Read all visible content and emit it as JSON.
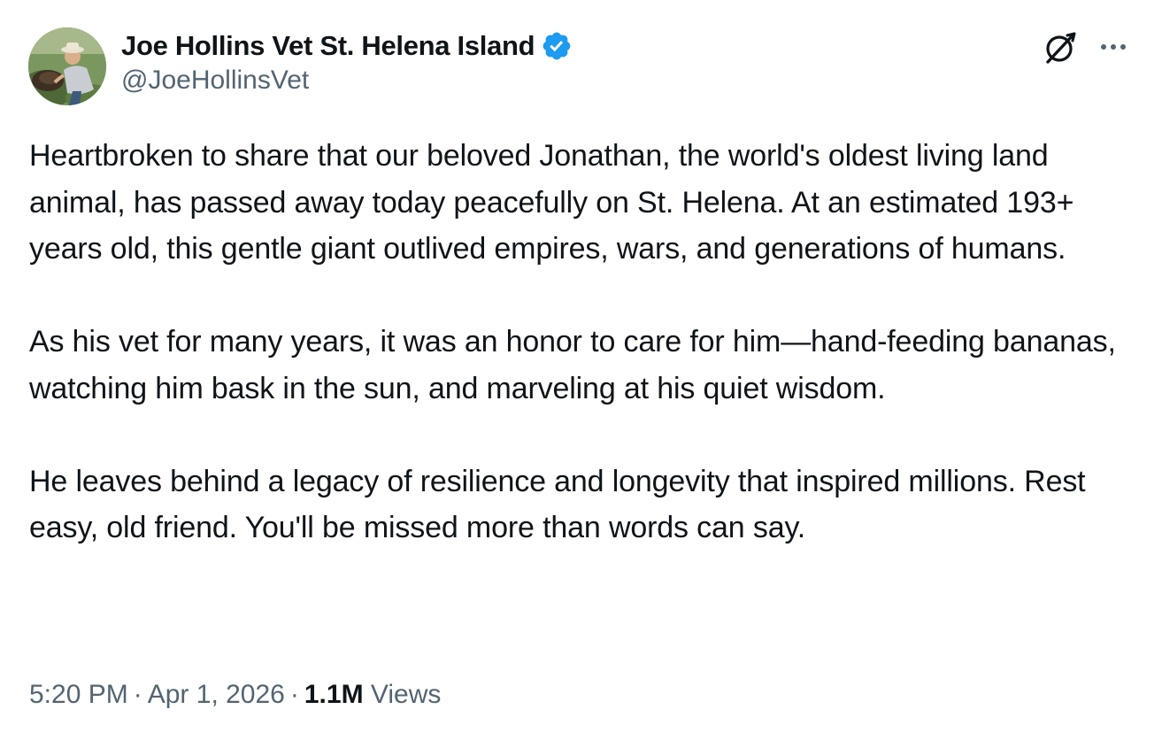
{
  "author": {
    "display_name": "Joe Hollins Vet St. Helena Island",
    "handle": "@JoeHollinsVet",
    "verified": true
  },
  "tweet": {
    "paragraphs": [
      "Heartbroken to share that our beloved Jonathan, the world's oldest living land animal, has passed away today peacefully on St. Helena. At an estimated 193+ years old, this gentle giant outlived empires, wars, and generations of humans.",
      "As his vet for many years, it was an honor to care for him—hand-feeding bananas, watching him bask in the sun, and marveling at his quiet wisdom.",
      "He leaves behind a legacy of resilience and longevity that inspired millions. Rest easy, old friend. You'll be missed more than words can say."
    ]
  },
  "meta": {
    "time": "5:20 PM",
    "separator": "·",
    "date": "Apr 1, 2026",
    "views_count": "1.1M",
    "views_label": "Views"
  },
  "icons": {
    "verified": "verified-badge-icon",
    "grok": "grok-icon",
    "more": "more-options-icon"
  },
  "colors": {
    "verified_blue": "#1d9bf0",
    "text_primary": "#0f1419",
    "text_secondary": "#536471"
  }
}
